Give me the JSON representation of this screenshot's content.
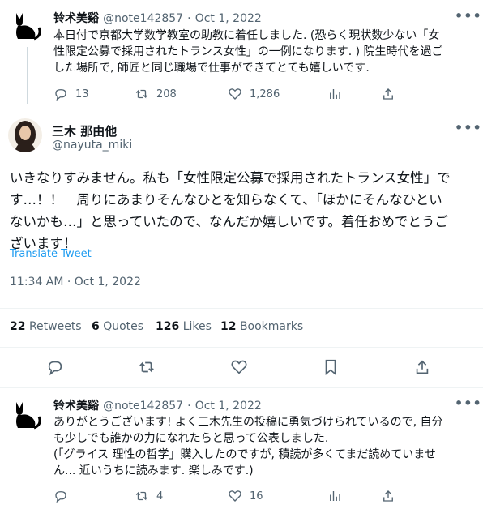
{
  "tweet1": {
    "name": "铃术美谿",
    "handle": "@note142857",
    "sep": "·",
    "date": "Oct 1, 2022",
    "lines": [
      "本日付で京都大学数学教室の助教に着任しました. (恐らく現状数少ない「女",
      "性限定公募で採用されたトランス女性」の一例になります. ) 院生時代を過ご",
      "した場所で, 師匠と同じ職場で仕事ができてとても嬉しいです."
    ],
    "replies": "13",
    "retweets": "208",
    "likes": "1,286"
  },
  "tweet2": {
    "name": "三木 那由他",
    "handle": "@nayuta_miki",
    "lines": [
      "いきなりすみません。私も「女性限定公募で採用されたトランス女性」で",
      "す…！！　周りにあまりそんなひとを知らなくて、「ほかにそんなひとい",
      "ないかも…」と思っていたので、なんだか嬉しいです。着任おめでとうご",
      "ざいます！"
    ],
    "translate": "Translate Tweet",
    "timestamp": "11:34 AM · Oct 1, 2022",
    "stats": {
      "retweets_num": "22",
      "retweets_label": "Retweets",
      "quotes_num": "6",
      "quotes_label": "Quotes",
      "likes_num": "126",
      "likes_label": "Likes",
      "bookmarks_num": "12",
      "bookmarks_label": "Bookmarks"
    }
  },
  "tweet3": {
    "name": "铃术美谿",
    "handle": "@note142857",
    "sep": "·",
    "date": "Oct 1, 2022",
    "lines": [
      "ありがとうございます! よく三木先生の投稿に勇気づけられているので, 自分",
      "も少しでも誰かの力になれたらと思って公表しました.",
      "(「グライス 理性の哲学」購入したのですが, 積読が多くてまだ読めていませ",
      "ん... 近いうちに読みます. 楽しみです.)"
    ],
    "retweets": "4",
    "likes": "16"
  },
  "more_icon": "•••",
  "icons": [
    "reply-icon",
    "retweet-icon",
    "like-icon",
    "views-icon",
    "share-icon",
    "bookmark-icon"
  ],
  "colors": {
    "link": "#1d9bf0",
    "secondary": "#536471",
    "divider": "#eff3f4"
  }
}
